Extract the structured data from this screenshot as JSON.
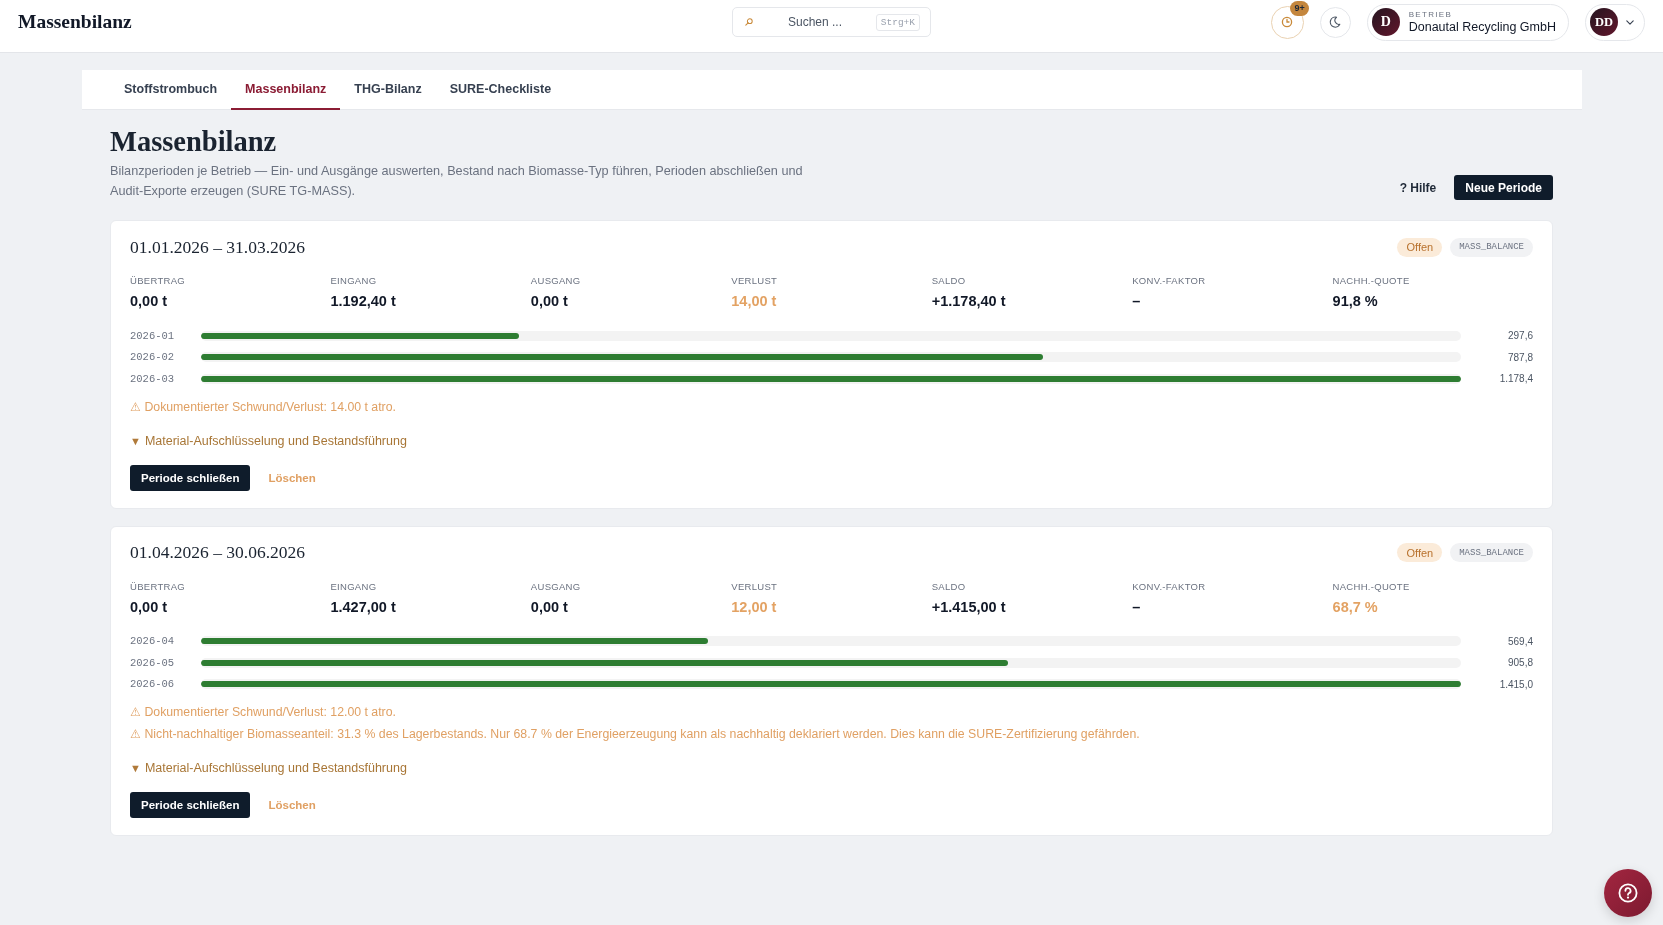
{
  "header": {
    "logo": "Massenbilanz",
    "search": {
      "placeholder": "Suchen ...",
      "shortcut": "Strg+K"
    },
    "notifications": {
      "badge": "9+"
    },
    "facility": {
      "initial": "D",
      "label": "BETRIEB",
      "name": "Donautal Recycling GmbH"
    },
    "user": {
      "initials": "DD"
    }
  },
  "tabs": [
    {
      "label": "Stoffstrombuch",
      "selected": false
    },
    {
      "label": "Massenbilanz",
      "selected": true
    },
    {
      "label": "THG-Bilanz",
      "selected": false
    },
    {
      "label": "SURE-Checkliste",
      "selected": false
    }
  ],
  "page": {
    "title": "Massenbilanz",
    "description": "Bilanzperioden je Betrieb — Ein- und Ausgänge auswerten, Bestand nach Biomasse-Typ führen, Perioden abschließen und Audit-Exporte erzeugen (SURE TG-MASS).",
    "help_button": "? Hilfe",
    "primary_button": "Neue Periode"
  },
  "periods": [
    {
      "title": "01.01.2026 – 31.03.2026",
      "badges": [
        {
          "kind": "status",
          "label": "Offen"
        },
        {
          "kind": "type",
          "label": "MASS_BALANCE"
        }
      ],
      "stats": [
        {
          "label": "ÜBERTRAG",
          "value": "0,00 t",
          "warning": false
        },
        {
          "label": "EINGANG",
          "value": "1.192,40 t",
          "warning": false
        },
        {
          "label": "AUSGANG",
          "value": "0,00 t",
          "warning": false
        },
        {
          "label": "VERLUST",
          "value": "14,00 t",
          "warning": true
        },
        {
          "label": "SALDO",
          "value": "+1.178,40 t",
          "warning": false
        },
        {
          "label": "KONV.-FAKTOR",
          "value": "–",
          "warning": false
        },
        {
          "label": "NACHH.-QUOTE",
          "value": "91,8 %",
          "warning": false
        }
      ],
      "months": [
        {
          "label": "2026-01",
          "level": 0.2525,
          "reading": "297,6"
        },
        {
          "label": "2026-02",
          "level": 0.6685,
          "reading": "787,8"
        },
        {
          "label": "2026-03",
          "level": 1,
          "reading": "1.178,4"
        }
      ],
      "warnings": [
        "⚠ Dokumentierter Schwund/Verlust: 14.00 t atro."
      ],
      "details": {
        "icon": "▼",
        "label": "Material-Aufschlüsselung und Bestandsführung"
      },
      "actions": [
        {
          "kind": "primary",
          "label": "Periode schließen"
        },
        {
          "kind": "danger",
          "label": "Löschen"
        }
      ]
    },
    {
      "title": "01.04.2026 – 30.06.2026",
      "badges": [
        {
          "kind": "status",
          "label": "Offen"
        },
        {
          "kind": "type",
          "label": "MASS_BALANCE"
        }
      ],
      "stats": [
        {
          "label": "ÜBERTRAG",
          "value": "0,00 t",
          "warning": false
        },
        {
          "label": "EINGANG",
          "value": "1.427,00 t",
          "warning": false
        },
        {
          "label": "AUSGANG",
          "value": "0,00 t",
          "warning": false
        },
        {
          "label": "VERLUST",
          "value": "12,00 t",
          "warning": true
        },
        {
          "label": "SALDO",
          "value": "+1.415,00 t",
          "warning": false
        },
        {
          "label": "KONV.-FAKTOR",
          "value": "–",
          "warning": false
        },
        {
          "label": "NACHH.-QUOTE",
          "value": "68,7 %",
          "warning": true
        }
      ],
      "months": [
        {
          "label": "2026-04",
          "level": 0.4024,
          "reading": "569,4"
        },
        {
          "label": "2026-05",
          "level": 0.6401,
          "reading": "905,8"
        },
        {
          "label": "2026-06",
          "level": 1,
          "reading": "1.415,0"
        }
      ],
      "warnings": [
        "⚠ Dokumentierter Schwund/Verlust: 12.00 t atro.",
        "⚠ Nicht-nachhaltiger Biomasseanteil: 31.3 % des Lagerbestands. Nur 68.7 % der Energieerzeugung kann als nachhaltig deklariert werden. Dies kann die SURE-Zertifizierung gefährden."
      ],
      "details": {
        "icon": "▼",
        "label": "Material-Aufschlüsselung und Bestandsführung"
      },
      "actions": [
        {
          "kind": "primary",
          "label": "Periode schließen"
        },
        {
          "kind": "danger",
          "label": "Löschen"
        }
      ]
    }
  ]
}
